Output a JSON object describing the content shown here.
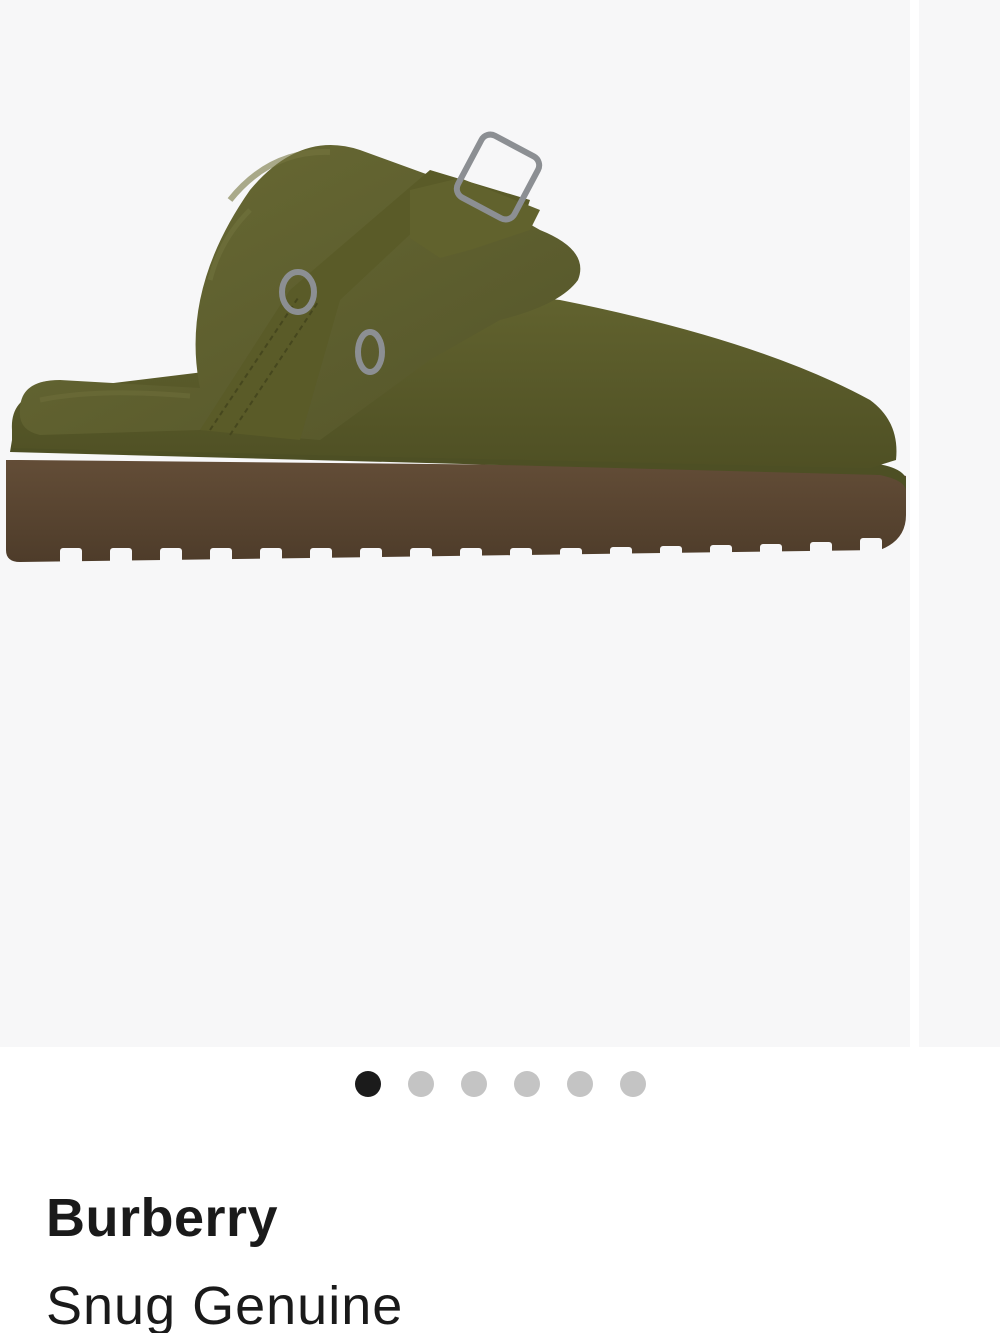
{
  "carousel": {
    "image_description_alt": "",
    "dot_count": 6,
    "active_index": 0,
    "colors": {
      "background": "#f7f7f8",
      "active_dot": "#1b1b1b",
      "inactive_dot": "#c4c4c4",
      "product_suede": "#5d5e2a",
      "product_fur": "#5f5f2c",
      "product_sole": "#5a4632"
    }
  },
  "product": {
    "brand": "Burberry",
    "name": "Snug Genuine"
  }
}
